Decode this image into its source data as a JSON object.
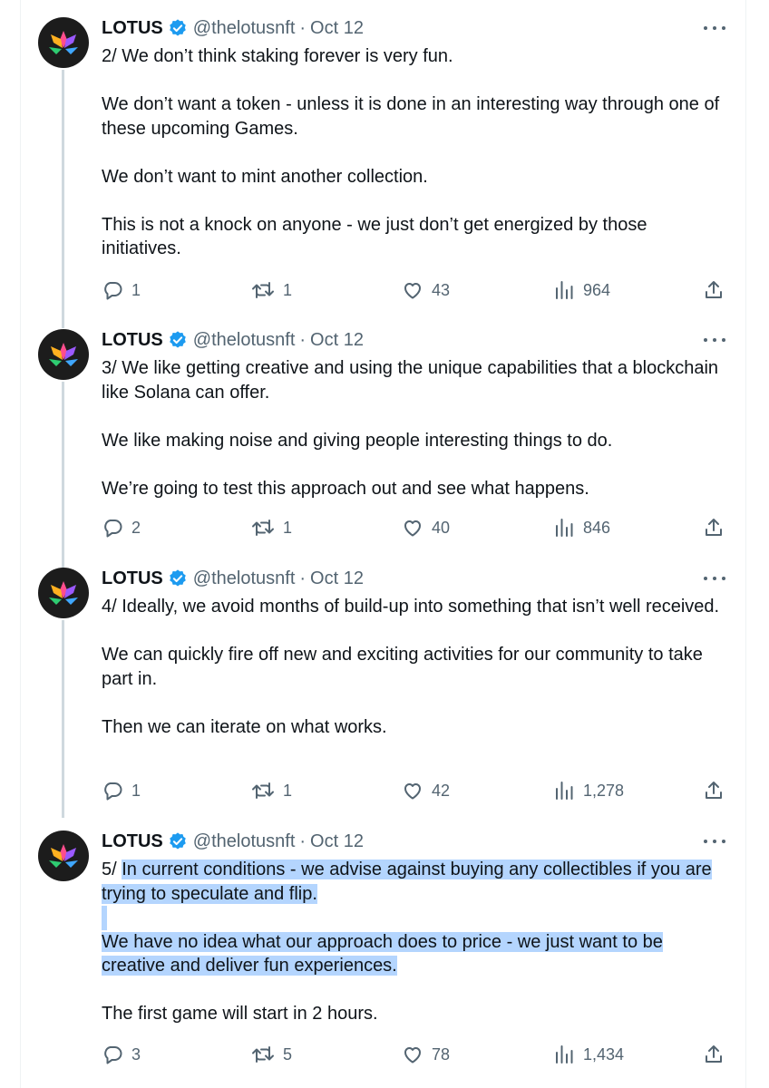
{
  "author": {
    "name": "LOTUS",
    "handle": "@thelotusnft",
    "separator": "·"
  },
  "colors": {
    "verified": "#1d9bf0",
    "highlight": "#b4d5fe",
    "secondary_text": "#536471",
    "thread_line": "#cfd9de"
  },
  "icons": [
    "lotus-logo-icon",
    "verified-badge-icon",
    "more-icon",
    "reply-icon",
    "retweet-icon",
    "like-icon",
    "views-icon",
    "share-icon"
  ],
  "tweets": [
    {
      "date": "Oct 12",
      "paragraphs": [
        "2/ We don’t think staking forever is very fun.",
        "We don’t want a token - unless it is done in an interesting way through one of these upcoming Games.",
        "We don’t want to mint another collection.",
        "This is not a knock on anyone - we just don’t get energized by those initiatives."
      ],
      "replies": "1",
      "retweets": "1",
      "likes": "43",
      "views": "964"
    },
    {
      "date": "Oct 12",
      "paragraphs": [
        "3/ We like getting creative and using the unique capabilities that a blockchain like Solana can offer.",
        "We like making noise and giving people interesting things to do.",
        "We’re going to test this approach out and see what happens."
      ],
      "replies": "2",
      "retweets": "1",
      "likes": "40",
      "views": "846"
    },
    {
      "date": "Oct 12",
      "paragraphs": [
        "4/ Ideally, we avoid months of build-up into something that isn’t well received.",
        "We can quickly fire off new and exciting activities for our community to take part in.",
        "Then we can iterate on what works."
      ],
      "replies": "1",
      "retweets": "1",
      "likes": "42",
      "views": "1,278"
    },
    {
      "date": "Oct 12",
      "prefix": "5/ ",
      "highlighted_1": "In current conditions - we advise against buying any collectibles if you are trying to speculate and flip.",
      "highlighted_2": "We have no idea what our approach does to price - we just want to be creative and deliver fun experiences.",
      "closing": "The first game will start in 2 hours.",
      "replies": "3",
      "retweets": "5",
      "likes": "78",
      "views": "1,434"
    }
  ]
}
